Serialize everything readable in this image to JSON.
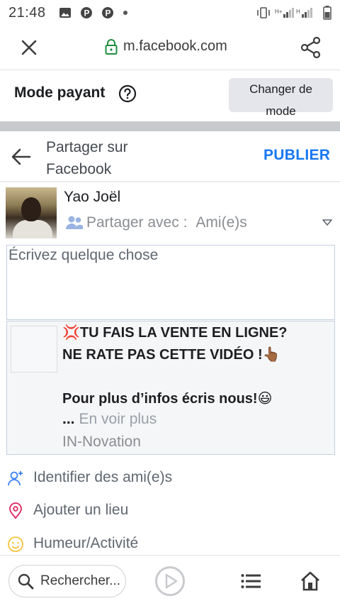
{
  "status_bar": {
    "time": "21:48",
    "icons": [
      "image-icon",
      "p-icon",
      "p-icon",
      "dot-icon",
      "vibrate-icon",
      "signal-icon",
      "battery-icon"
    ]
  },
  "browser": {
    "url": "m.facebook.com",
    "close_icon": "close-icon",
    "share_icon": "share-icon",
    "lock_icon": "lock-icon",
    "lock_color": "#1e8e3e"
  },
  "mode_bar": {
    "title": "Mode payant",
    "help_icon": "help-icon",
    "switch_line1": "Changer de",
    "switch_line2": "mode"
  },
  "share_header": {
    "title_line1": "Partager sur",
    "title_line2": "Facebook",
    "publish_label": "PUBLIER",
    "publish_color": "#1877f2"
  },
  "user": {
    "name": "Yao Joël",
    "audience_label": "Partager avec :",
    "audience_value": "Ami(e)s"
  },
  "composer": {
    "placeholder": "Écrivez quelque chose"
  },
  "preview": {
    "line1": "💢TU FAIS LA VENTE EN LIGNE?",
    "line2": "NE RATE PAS CETTE VIDÉO !👆🏾",
    "line3": "Pour plus d’infos écris nous!😃",
    "ellipsis": "...",
    "see_more": "En voir plus",
    "source": "IN-Novation"
  },
  "actions": [
    {
      "label": "Identifier des ami(e)s",
      "icon": "tag-friends-icon",
      "color": "#3b82f6"
    },
    {
      "label": "Ajouter un lieu",
      "icon": "location-pin-icon",
      "color": "#e0245e"
    },
    {
      "label": "Humeur/Activité",
      "icon": "smiley-icon",
      "color": "#f5c33b"
    }
  ],
  "bottom_nav": {
    "search_placeholder": "Rechercher...",
    "icons": [
      "search-icon",
      "play-icon",
      "menu-icon",
      "home-icon"
    ]
  }
}
